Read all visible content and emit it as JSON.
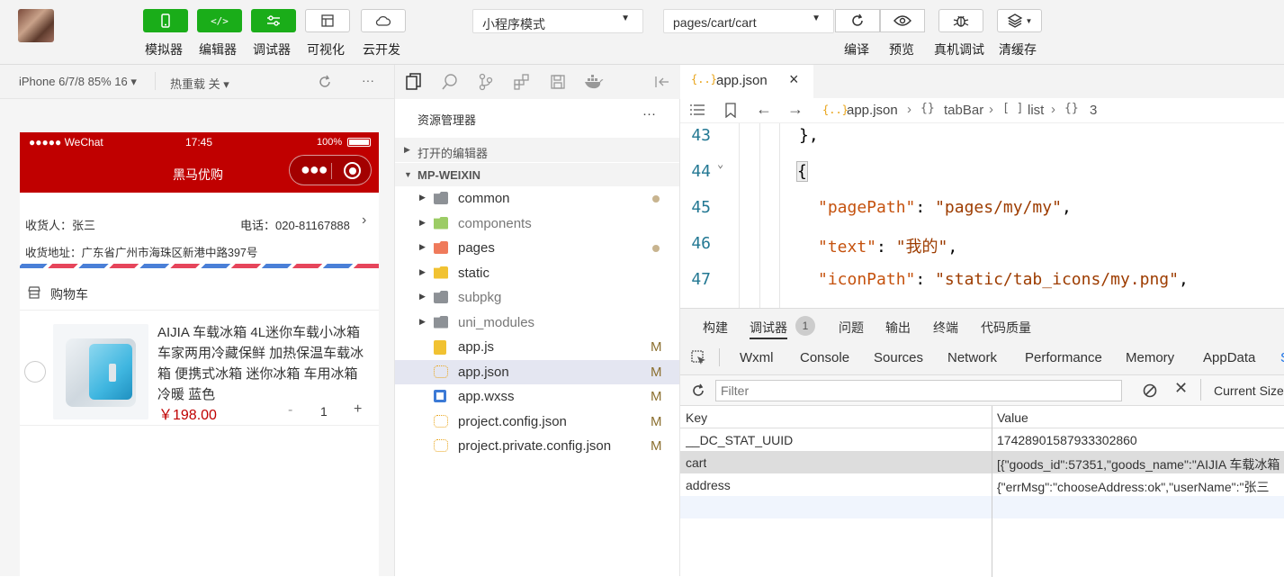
{
  "toolbar": {
    "buttons": [
      {
        "label": "模拟器",
        "icon": "phone-icon"
      },
      {
        "label": "编辑器",
        "icon": "code-icon"
      },
      {
        "label": "调试器",
        "icon": "sliders-icon"
      },
      {
        "label": "可视化",
        "icon": "layout-icon"
      },
      {
        "label": "云开发",
        "icon": "cloud-icon"
      }
    ],
    "mode_select": "小程序模式",
    "page_select": "pages/cart/cart",
    "right_buttons": [
      {
        "label": "编译",
        "icon": "refresh-icon"
      },
      {
        "label": "预览",
        "icon": "eye-icon"
      },
      {
        "label": "真机调试",
        "icon": "bug-icon"
      },
      {
        "label": "清缓存",
        "icon": "layers-icon"
      }
    ]
  },
  "simulator": {
    "device": "iPhone 6/7/8 85% 16 ▾",
    "hot_reload": "热重载 关 ▾",
    "more": "···",
    "status": {
      "carrier": "●●●●● WeChat",
      "time": "17:45",
      "battery": "100%"
    },
    "nav_title": "黑马优购",
    "address": {
      "receiver_label": "收货人：张三",
      "phone_label": "电话：020-81167888",
      "address_label": "收货地址：广东省广州市海珠区新港中路397号"
    },
    "cart_title": "购物车",
    "goods": {
      "name": "AIJIA 车载冰箱 4L迷你车载小冰箱 车家两用冷藏保鲜 加热保温车载冰箱 便携式冰箱 迷你冰箱 车用冰箱 冷暖 蓝色",
      "price": "￥198.00",
      "count": "1",
      "minus": "-",
      "plus": "+"
    }
  },
  "explorer": {
    "title": "资源管理器",
    "more": "···",
    "open_editors": "打开的编辑器",
    "project": "MP-WEIXIN",
    "items": [
      {
        "name": "common",
        "type": "folder",
        "arrow": "▶",
        "status": "dot",
        "color": "#8d9196"
      },
      {
        "name": "components",
        "type": "folder",
        "arrow": "▶",
        "status": "",
        "color": "#9ccc65"
      },
      {
        "name": "pages",
        "type": "folder",
        "arrow": "▶",
        "status": "dot",
        "color": "#ef7a5b"
      },
      {
        "name": "static",
        "type": "folder",
        "arrow": "▶",
        "status": "",
        "color": "#f1c232"
      },
      {
        "name": "subpkg",
        "type": "folder",
        "arrow": "▶",
        "status": "",
        "color": "#8d9196"
      },
      {
        "name": "uni_modules",
        "type": "folder",
        "arrow": "▶",
        "status": "",
        "color": "#8d9196"
      },
      {
        "name": "app.js",
        "type": "js",
        "arrow": "",
        "status": "M",
        "color": "#f1c232"
      },
      {
        "name": "app.json",
        "type": "json",
        "arrow": "",
        "status": "M",
        "color": "#e8a317"
      },
      {
        "name": "app.wxss",
        "type": "css",
        "arrow": "",
        "status": "M",
        "color": "#3c7ad6"
      },
      {
        "name": "project.config.json",
        "type": "json",
        "arrow": "",
        "status": "M",
        "color": "#e8a317"
      },
      {
        "name": "project.private.config.json",
        "type": "json",
        "arrow": "",
        "status": "M",
        "color": "#e8a317"
      }
    ]
  },
  "editor": {
    "tab_label": "app.json",
    "tab_icon": "{..}",
    "breadcrumb": [
      "app.json",
      "tabBar",
      "list",
      "3"
    ],
    "lines": [
      {
        "num": "43",
        "text": "},"
      },
      {
        "num": "44",
        "text": "{"
      },
      {
        "num": "45",
        "key": "\"pagePath\"",
        "value": "\"pages/my/my\""
      },
      {
        "num": "46",
        "key": "\"text\"",
        "value": "\"我的\""
      },
      {
        "num": "47",
        "key": "\"iconPath\"",
        "value": "\"static/tab_icons/my.png\""
      }
    ]
  },
  "devtools": {
    "tabs_top": [
      {
        "label": "构建"
      },
      {
        "label": "调试器",
        "badge": "1"
      },
      {
        "label": "问题"
      },
      {
        "label": "输出"
      },
      {
        "label": "终端"
      },
      {
        "label": "代码质量"
      }
    ],
    "tabs_panel": [
      "Wxml",
      "Console",
      "Sources",
      "Network",
      "Performance",
      "Memory",
      "AppData",
      "S"
    ],
    "filter_placeholder": "Filter",
    "current_size": "Current Size",
    "columns": [
      "Key",
      "Value"
    ],
    "rows": [
      {
        "key": "__DC_STAT_UUID",
        "value": "17428901587933302860"
      },
      {
        "key": "cart",
        "value": "[{\"goods_id\":57351,\"goods_name\":\"AIJIA 车载冰箱"
      },
      {
        "key": "address",
        "value": "{\"errMsg\":\"chooseAddress:ok\",\"userName\":\"张三"
      }
    ]
  }
}
